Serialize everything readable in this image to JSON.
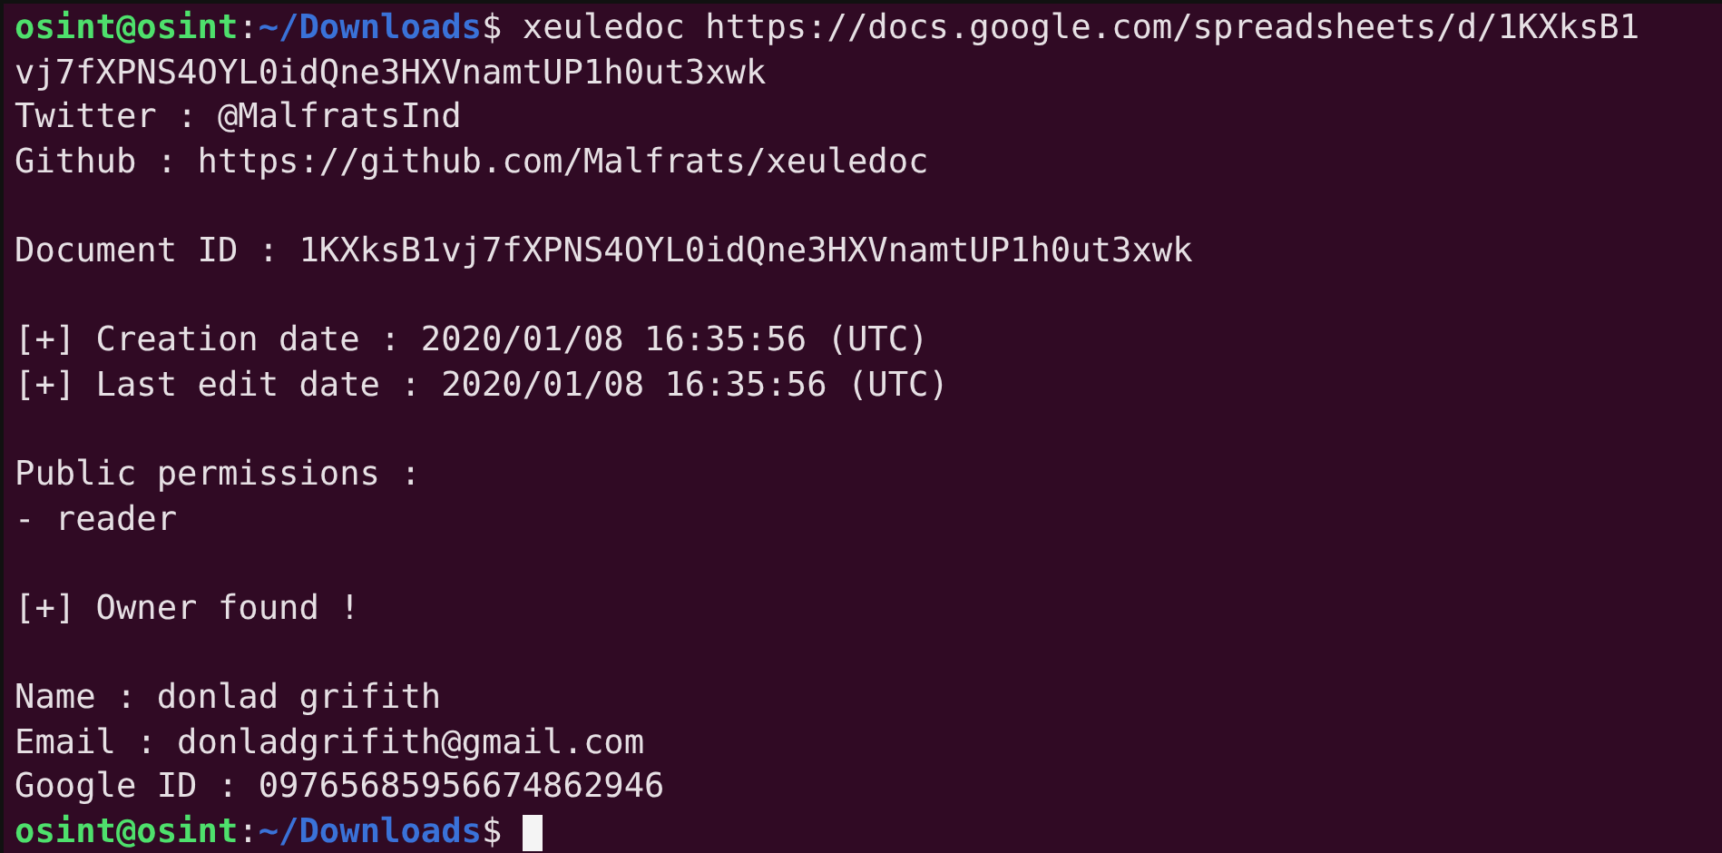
{
  "terminal": {
    "lines": [
      {
        "kind": "prompt",
        "user": "osint@osint",
        "separator": ":",
        "path": "~/Downloads",
        "symbol": "$",
        "command": "xeuledoc https://docs.google.com/spreadsheets/d/1KXksB1"
      },
      {
        "kind": "text",
        "text": "vj7fXPNS4OYL0idQne3HXVnamtUP1h0ut3xwk"
      },
      {
        "kind": "text",
        "text": "Twitter : @MalfratsInd"
      },
      {
        "kind": "text",
        "text": "Github : https://github.com/Malfrats/xeuledoc"
      },
      {
        "kind": "blank"
      },
      {
        "kind": "text",
        "text": "Document ID : 1KXksB1vj7fXPNS4OYL0idQne3HXVnamtUP1h0ut3xwk"
      },
      {
        "kind": "blank"
      },
      {
        "kind": "text",
        "text": "[+] Creation date : 2020/01/08 16:35:56 (UTC)"
      },
      {
        "kind": "text",
        "text": "[+] Last edit date : 2020/01/08 16:35:56 (UTC)"
      },
      {
        "kind": "blank"
      },
      {
        "kind": "text",
        "text": "Public permissions :"
      },
      {
        "kind": "text",
        "text": "- reader"
      },
      {
        "kind": "blank"
      },
      {
        "kind": "text",
        "text": "[+] Owner found !"
      },
      {
        "kind": "blank"
      },
      {
        "kind": "text",
        "text": "Name : donlad grifith"
      },
      {
        "kind": "text",
        "text": "Email : donladgrifith@gmail.com"
      },
      {
        "kind": "text",
        "text": "Google ID : 09765685956674862946"
      },
      {
        "kind": "prompt",
        "user": "osint@osint",
        "separator": ":",
        "path": "~/Downloads",
        "symbol": "$",
        "cursor": true
      }
    ]
  }
}
